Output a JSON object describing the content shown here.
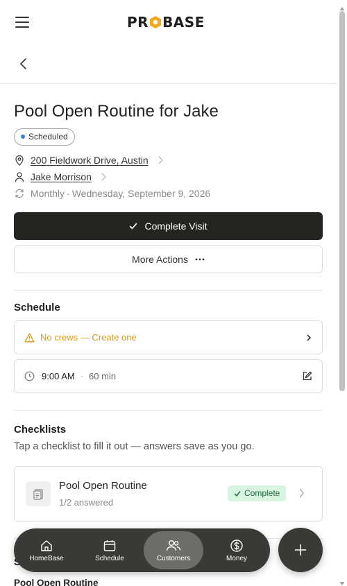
{
  "app": {
    "logo_text_left": "PR",
    "logo_text_right": "BASE"
  },
  "visit": {
    "title": "Pool Open Routine for Jake",
    "status": "Scheduled",
    "address": "200 Fieldwork Drive, Austin",
    "customer": "Jake Morrison",
    "recurrence": "Monthly",
    "recurrence_sep": "·",
    "date": "Wednesday, September 9, 2026"
  },
  "actions": {
    "complete_label": "Complete Visit",
    "more_label": "More Actions"
  },
  "schedule": {
    "section_title": "Schedule",
    "crew_warning": "No crews — Create one",
    "time": "9:00 AM",
    "sep": "·",
    "duration": "60 min"
  },
  "checklists": {
    "section_title": "Checklists",
    "subtitle": "Tap a checklist to fill it out — answers save as you go.",
    "items": [
      {
        "name": "Pool Open Routine",
        "answered": "1/2 answered",
        "status": "Complete"
      }
    ]
  },
  "partial": {
    "section_initial": "S",
    "item": "Pool Open Routine"
  },
  "nav": {
    "items": [
      {
        "label": "HomeBase"
      },
      {
        "label": "Schedule"
      },
      {
        "label": "Customers"
      },
      {
        "label": "Money"
      }
    ]
  },
  "colors": {
    "accent_dark": "#262421",
    "logo_orange": "#f2a81d",
    "status_dot": "#3b7dd8",
    "warning": "#d39a1c",
    "complete_bg": "#d8f5e2",
    "complete_text": "#1f6a3c",
    "nav_bg": "#3a3936"
  }
}
